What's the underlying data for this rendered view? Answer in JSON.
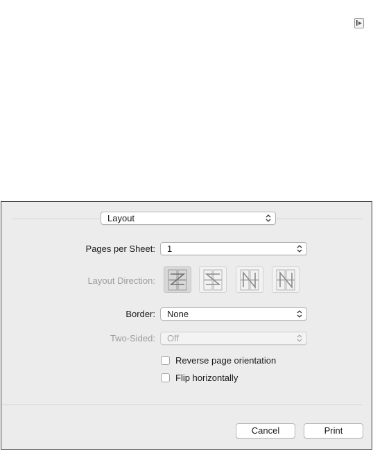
{
  "dialog": {
    "section_selector": {
      "value": "Layout"
    },
    "pages_per_sheet": {
      "label": "Pages per Sheet:",
      "value": "1"
    },
    "layout_direction": {
      "label": "Layout Direction:",
      "options": [
        "z-order-icon",
        "reverse-s-order-icon",
        "reverse-n-order-icon",
        "n-order-icon"
      ],
      "selected": 0
    },
    "border": {
      "label": "Border:",
      "value": "None"
    },
    "two_sided": {
      "label": "Two-Sided:",
      "value": "Off",
      "enabled": false
    },
    "reverse_orientation": {
      "label": "Reverse page orientation",
      "checked": false
    },
    "flip_horizontally": {
      "label": "Flip horizontally",
      "checked": false
    },
    "buttons": {
      "cancel": "Cancel",
      "print": "Print"
    }
  },
  "colors": {
    "dialog_bg": "#ececec",
    "dialog_border": "#3a3a3a",
    "disabled_text": "#9c9c9c"
  }
}
